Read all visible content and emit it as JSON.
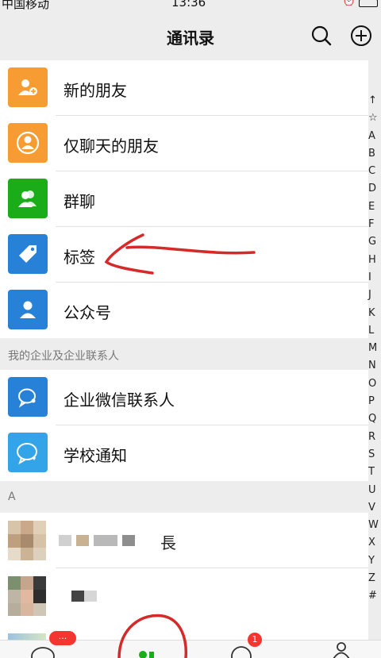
{
  "status_bar": {
    "carrier": "中国移动",
    "time": "13:36"
  },
  "header": {
    "title": "通讯录",
    "search_icon": "search-icon",
    "add_icon": "plus-circle-icon"
  },
  "function_items": [
    {
      "label": "新的朋友",
      "icon": "add-friend-icon",
      "color": "#f79c33"
    },
    {
      "label": "仅聊天的朋友",
      "icon": "chat-only-friend-icon",
      "color": "#f79c33"
    },
    {
      "label": "群聊",
      "icon": "group-chat-icon",
      "color": "#1aad19"
    },
    {
      "label": "标签",
      "icon": "tag-icon",
      "color": "#2782d7"
    },
    {
      "label": "公众号",
      "icon": "official-account-icon",
      "color": "#2782d7"
    }
  ],
  "enterprise_section": {
    "header": "我的企业及企业联系人",
    "items": [
      {
        "label": "企业微信联系人",
        "icon": "enterprise-contact-icon",
        "color": "#2782d7"
      },
      {
        "label": "学校通知",
        "icon": "school-notice-icon",
        "color": "#34a4e8"
      }
    ]
  },
  "contacts_section": {
    "header": "A",
    "first_contact_visible_text": "長"
  },
  "index_bar": [
    "↑",
    "☆",
    "A",
    "B",
    "C",
    "D",
    "E",
    "F",
    "G",
    "H",
    "I",
    "J",
    "K",
    "L",
    "M",
    "N",
    "O",
    "P",
    "Q",
    "R",
    "S",
    "T",
    "U",
    "V",
    "W",
    "X",
    "Y",
    "Z",
    "#"
  ],
  "tab_bar": {
    "chats_badge": "...",
    "discover_badge": "1"
  },
  "colors": {
    "background": "#ededed",
    "annotation_red": "#d42a2a"
  }
}
